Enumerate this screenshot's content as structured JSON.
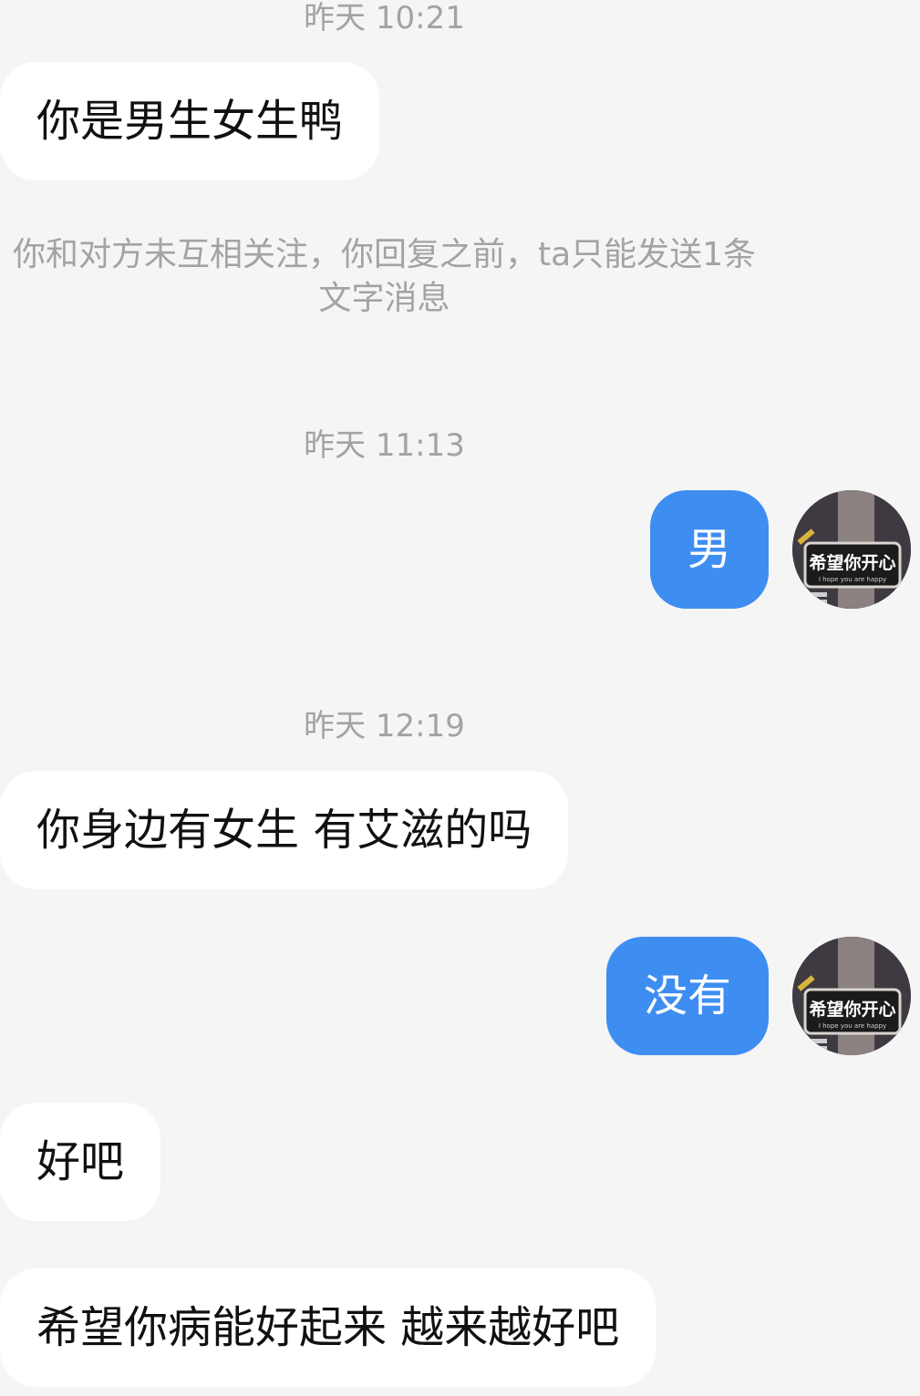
{
  "messages": [
    {
      "type": "time",
      "text": "昨天 10:21"
    },
    {
      "type": "in",
      "text": "你是男生女生鸭"
    },
    {
      "type": "notice",
      "text": "你和对方未互相关注，你回复之前，ta只能发送1条文字消息"
    },
    {
      "type": "time",
      "text": "昨天 11:13"
    },
    {
      "type": "out",
      "text": "男"
    },
    {
      "type": "time",
      "text": "昨天 12:19"
    },
    {
      "type": "in",
      "text": "你身边有女生 有艾滋的吗"
    },
    {
      "type": "out",
      "text": "没有"
    },
    {
      "type": "in",
      "text": "好吧"
    },
    {
      "type": "in",
      "text": "希望你病能好起来  越来越好吧"
    }
  ],
  "avatar": {
    "sign_text": "希望你开心",
    "sign_subtext": "I hope you are happy"
  },
  "colors": {
    "background": "#f5f5f5",
    "incoming_bubble": "#ffffff",
    "outgoing_bubble": "#3e8df1",
    "meta_text": "#a3a3a3"
  }
}
